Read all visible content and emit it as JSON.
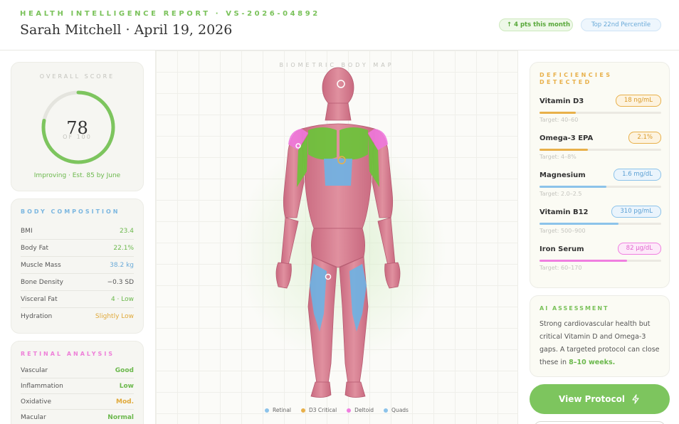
{
  "header": {
    "report_id": "HEALTH INTELLIGENCE REPORT · VS-2026-04892",
    "title": "Sarah Mitchell · April 19, 2026",
    "trend_pill": "↑ 4 pts this month",
    "percentile_pill": "Top 22nd Percentile"
  },
  "score": {
    "kicker": "OVERALL SCORE",
    "value": "78",
    "out_of": "OF 100",
    "fraction": 0.78,
    "status": "Improving · Est. 85 by June"
  },
  "composition": {
    "title": "BODY COMPOSITION",
    "rows": [
      {
        "label": "BMI",
        "value": "23.4",
        "color": "#6bb84c"
      },
      {
        "label": "Body Fat",
        "value": "22.1%",
        "color": "#6bb84c"
      },
      {
        "label": "Muscle Mass",
        "value": "38.2 kg",
        "color": "#6aaad8"
      },
      {
        "label": "Bone Density",
        "value": "−0.3 SD",
        "color": "#555555"
      },
      {
        "label": "Visceral Fat",
        "value": "4 · Low",
        "color": "#6bb84c"
      },
      {
        "label": "Hydration",
        "value": "Slightly Low",
        "color": "#e0a93a"
      }
    ]
  },
  "retinal": {
    "title": "RETINAL ANALYSIS",
    "rows": [
      {
        "label": "Vascular",
        "value": "Good",
        "color": "#6bb84c"
      },
      {
        "label": "Inflammation",
        "value": "Low",
        "color": "#6bb84c"
      },
      {
        "label": "Oxidative",
        "value": "Mod.",
        "color": "#e0a93a"
      },
      {
        "label": "Macular",
        "value": "Normal",
        "color": "#6bb84c"
      }
    ]
  },
  "body_map": {
    "title": "BIOMETRIC BODY MAP",
    "legend": [
      {
        "label": "Retinal",
        "color": "#8cc3ea"
      },
      {
        "label": "D3 Critical",
        "color": "#e8b04a"
      },
      {
        "label": "Deltoid",
        "color": "#f07fe0"
      },
      {
        "label": "Quads",
        "color": "#8cc3ea"
      }
    ]
  },
  "deficiencies": {
    "title": "DEFICIENCIES DETECTED",
    "items": [
      {
        "name": "Vitamin D3",
        "value": "18 ng/mL",
        "target": "Target: 40–60",
        "level": 0.3,
        "color": "#e8b04a",
        "badge_bg": "#fdf3df",
        "badge_fg": "#d99a2a"
      },
      {
        "name": "Omega-3 EPA",
        "value": "2.1%",
        "target": "Target: 4–8%",
        "level": 0.4,
        "color": "#e8b04a",
        "badge_bg": "#fdf3df",
        "badge_fg": "#d99a2a"
      },
      {
        "name": "Magnesium",
        "value": "1.6 mg/dL",
        "target": "Target: 2.0–2.5",
        "level": 0.55,
        "color": "#8cc3ea",
        "badge_bg": "#eaf4fc",
        "badge_fg": "#5b9fd3"
      },
      {
        "name": "Vitamin B12",
        "value": "310 pg/mL",
        "target": "Target: 500–900",
        "level": 0.65,
        "color": "#8cc3ea",
        "badge_bg": "#eaf4fc",
        "badge_fg": "#5b9fd3"
      },
      {
        "name": "Iron Serum",
        "value": "82 μg/dL",
        "target": "Target: 60–170",
        "level": 0.72,
        "color": "#f07fe0",
        "badge_bg": "#fde9f9",
        "badge_fg": "#e266cf"
      }
    ]
  },
  "ai": {
    "title": "AI ASSESSMENT",
    "text": "Strong cardiovascular health but critical Vitamin D and Omega-3 gaps. A targeted protocol can close these in ",
    "highlight": "8–10 weeks."
  },
  "cta": {
    "label": "View Protocol"
  }
}
